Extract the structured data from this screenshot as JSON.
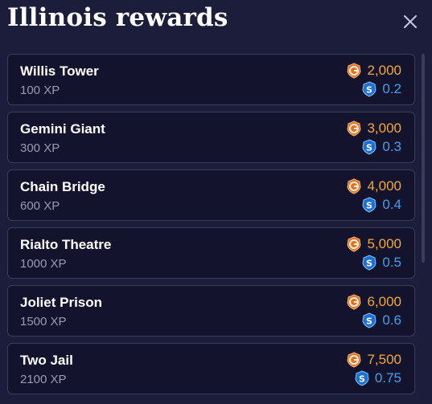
{
  "header": {
    "title": "Illinois rewards",
    "close_icon": "close-icon"
  },
  "colors": {
    "background": "#1c1c3b",
    "card": "#13132d",
    "gold": "#f0a93a",
    "silver": "#3fa0ef"
  },
  "rewards": [
    {
      "name": "Willis Tower",
      "xp": "100 XP",
      "gold": "2,000",
      "silver": "0.2"
    },
    {
      "name": "Gemini Giant",
      "xp": "300 XP",
      "gold": "3,000",
      "silver": "0.3"
    },
    {
      "name": "Chain Bridge",
      "xp": "600 XP",
      "gold": "4,000",
      "silver": "0.4"
    },
    {
      "name": "Rialto Theatre",
      "xp": "1000 XP",
      "gold": "5,000",
      "silver": "0.5"
    },
    {
      "name": "Joliet Prison",
      "xp": "1500 XP",
      "gold": "6,000",
      "silver": "0.6"
    },
    {
      "name": "Two Jail",
      "xp": "2100 XP",
      "gold": "7,500",
      "silver": "0.75"
    }
  ]
}
